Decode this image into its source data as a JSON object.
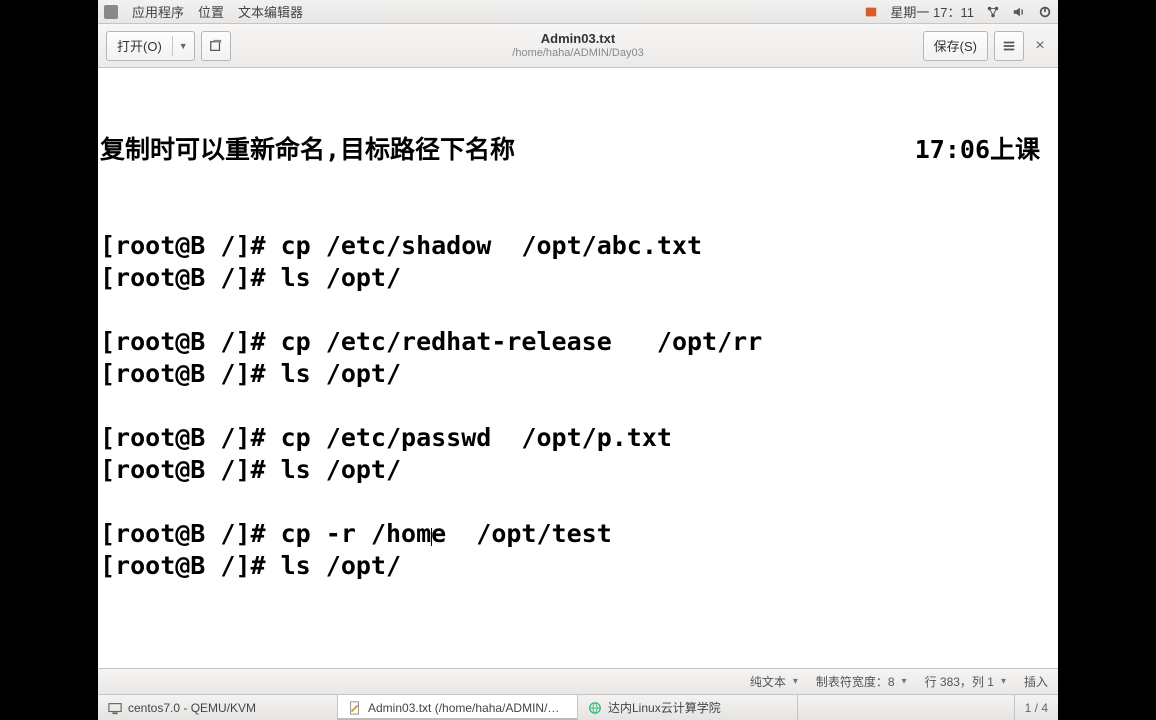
{
  "sysbar": {
    "menu_apps": "应用程序",
    "menu_places": "位置",
    "menu_editor": "文本编辑器",
    "clock": "星期一 17：11"
  },
  "editorbar": {
    "open_label": "打开(O)",
    "save_label": "保存(S)",
    "title": "Admin03.txt",
    "path": "/home/haha/ADMIN/Day03"
  },
  "content": {
    "headline_left": "复制时可以重新命名,目标路径下名称",
    "headline_right": "17:06上课",
    "lines": [
      "[root@B /]# cp /etc/shadow  /opt/abc.txt",
      "[root@B /]# ls /opt/",
      "",
      "[root@B /]# cp /etc/redhat-release   /opt/rr",
      "[root@B /]# ls /opt/",
      "",
      "[root@B /]# cp /etc/passwd  /opt/p.txt",
      "[root@B /]# ls /opt/",
      "",
      "[root@B /]# cp -r /home  /opt/test",
      "[root@B /]# ls /opt/"
    ]
  },
  "status": {
    "filetype": "纯文本",
    "tabwidth": "制表符宽度：8",
    "position": "行 383，列 1",
    "mode": "插入"
  },
  "taskbar": {
    "task1": "centos7.0 - QEMU/KVM",
    "task2": "Admin03.txt (/home/haha/ADMIN/…",
    "task3": "达内Linux云计算学院",
    "workspace": "1 / 4"
  }
}
